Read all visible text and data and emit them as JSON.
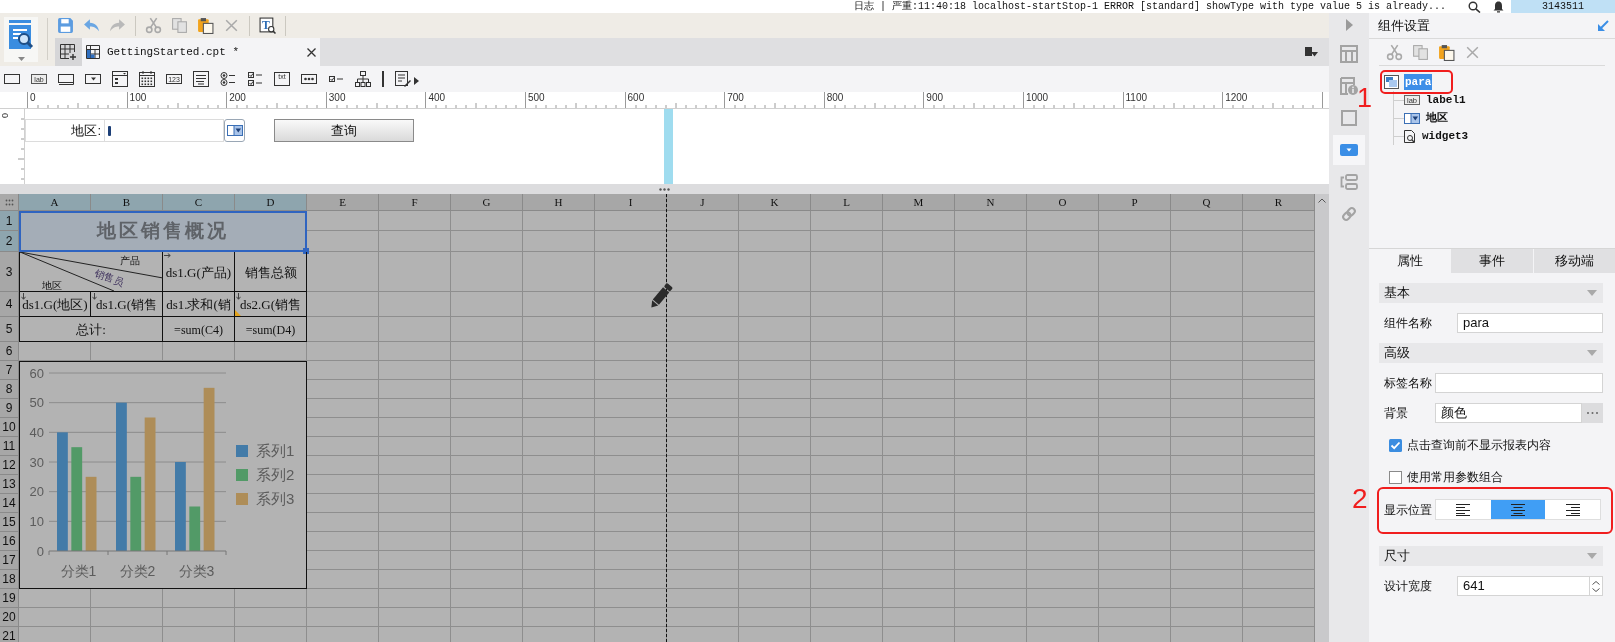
{
  "log_bar": {
    "message": "日志 | 严重:11:40:18 localhost-startStop-1 ERROR [standard] showType with type value 5 is already...",
    "counter": "3143511"
  },
  "toolbar": [
    {
      "kind": "save",
      "disabled": false
    },
    {
      "kind": "undo",
      "disabled": false
    },
    {
      "kind": "redo",
      "disabled": true
    },
    {
      "kind": "separator"
    },
    {
      "kind": "cut",
      "disabled": true
    },
    {
      "kind": "copy",
      "disabled": true
    },
    {
      "kind": "paste",
      "disabled": false
    },
    {
      "kind": "delete",
      "disabled": true
    },
    {
      "kind": "separator"
    },
    {
      "kind": "preview",
      "glyph": "T",
      "disabled": false
    },
    {
      "kind": "separator"
    }
  ],
  "document_tabs": [
    {
      "label": "GettingStarted.cpt *",
      "selected": true
    }
  ],
  "widget_toolbar": [
    {
      "kind": "text-field"
    },
    {
      "kind": "label",
      "glyph": "lab"
    },
    {
      "kind": "button"
    },
    {
      "kind": "dropdown"
    },
    {
      "kind": "dropdown-tree"
    },
    {
      "kind": "date"
    },
    {
      "kind": "number",
      "glyph": "123"
    },
    {
      "kind": "text-area"
    },
    {
      "kind": "radio-group"
    },
    {
      "kind": "checkbox-group"
    },
    {
      "kind": "file",
      "glyph": "txt"
    },
    {
      "kind": "password"
    },
    {
      "kind": "checkbox"
    },
    {
      "kind": "tree"
    },
    {
      "kind": "separator"
    },
    {
      "kind": "list-edit"
    },
    {
      "kind": "more"
    }
  ],
  "ruler": {
    "marks": [
      "0",
      "100",
      "200",
      "300",
      "400",
      "500",
      "600",
      "700",
      "800",
      "900",
      "1000",
      "1100",
      "1200"
    ],
    "vertical_marks": [
      "0"
    ]
  },
  "parameter_panel": {
    "label": "地区:",
    "field": {
      "focused": true
    },
    "button": "查询"
  },
  "sheet": {
    "columns": [
      {
        "label": "A",
        "selected": true
      },
      {
        "label": "B",
        "selected": true
      },
      {
        "label": "C",
        "selected": true
      },
      {
        "label": "D",
        "selected": true
      },
      {
        "label": "E",
        "selected": false
      },
      {
        "label": "F",
        "selected": false
      },
      {
        "label": "G",
        "selected": false
      },
      {
        "label": "H",
        "selected": false
      },
      {
        "label": "I",
        "selected": false
      },
      {
        "label": "J",
        "selected": false
      },
      {
        "label": "K",
        "selected": false
      },
      {
        "label": "L",
        "selected": false
      },
      {
        "label": "M",
        "selected": false
      },
      {
        "label": "N",
        "selected": false
      },
      {
        "label": "O",
        "selected": false
      },
      {
        "label": "P",
        "selected": false
      },
      {
        "label": "Q",
        "selected": false
      },
      {
        "label": "R",
        "selected": false
      }
    ],
    "rows": [
      {
        "label": "1",
        "selected": true
      },
      {
        "label": "2",
        "selected": true
      },
      {
        "label": "3",
        "selected": false
      },
      {
        "label": "4",
        "selected": false
      },
      {
        "label": "5",
        "selected": false
      },
      {
        "label": "6",
        "selected": false
      },
      {
        "label": "7",
        "selected": false
      },
      {
        "label": "8",
        "selected": false
      },
      {
        "label": "9",
        "selected": false
      },
      {
        "label": "10",
        "selected": false
      },
      {
        "label": "11",
        "selected": false
      },
      {
        "label": "12",
        "selected": false
      },
      {
        "label": "13",
        "selected": false
      },
      {
        "label": "14",
        "selected": false
      },
      {
        "label": "15",
        "selected": false
      },
      {
        "label": "16",
        "selected": false
      },
      {
        "label": "17",
        "selected": false
      },
      {
        "label": "18",
        "selected": false
      },
      {
        "label": "19",
        "selected": false
      },
      {
        "label": "20",
        "selected": false
      },
      {
        "label": "21",
        "selected": false
      }
    ]
  },
  "report": {
    "title": {
      "text": "地区销售概况",
      "selected": true
    },
    "slash_header": [
      "产品",
      "销售员",
      "地区"
    ],
    "header_cells": [
      {
        "text": "ds1.G(产品)",
        "expands_down": false,
        "expands_right": true,
        "flag": false
      },
      {
        "text": "销售总额",
        "expands_down": false,
        "expands_right": false,
        "flag": false
      }
    ],
    "data_cells": [
      {
        "text": "ds1.G(地区)",
        "expands_down": true,
        "expands_right": false,
        "flag": false
      },
      {
        "text": "ds1.G(销售",
        "expands_down": true,
        "expands_right": false,
        "flag": false
      },
      {
        "text": "ds1.求和(销",
        "expands_down": false,
        "expands_right": false,
        "flag": false
      },
      {
        "text": "ds2.G(销售",
        "expands_down": true,
        "expands_right": false,
        "flag": true
      }
    ],
    "total_cells": [
      "总计:",
      "=sum(C4)",
      "=sum(D4)"
    ],
    "chart": {
      "chart_data": {
        "type": "bar",
        "categories": [
          "分类1",
          "分类2",
          "分类3"
        ],
        "series": [
          {
            "name": "系列1",
            "color": "#437ba8",
            "values": [
              40,
              50,
              30
            ]
          },
          {
            "name": "系列2",
            "color": "#529a67",
            "values": [
              35,
              25,
              15
            ]
          },
          {
            "name": "系列3",
            "color": "#ae8d58",
            "values": [
              25,
              45,
              55
            ]
          }
        ],
        "ylim": [
          0,
          60
        ],
        "yticks": [
          0,
          10,
          20,
          30,
          40,
          50,
          60
        ],
        "grid": true,
        "legend": true
      }
    }
  },
  "side_strip": [
    {
      "kind": "collapse",
      "selected": false
    },
    {
      "kind": "cell-element",
      "selected": false
    },
    {
      "kind": "cell-attributes",
      "selected": false
    },
    {
      "kind": "widget-frame",
      "selected": false
    },
    {
      "kind": "widget-settings",
      "selected": true
    },
    {
      "kind": "widget-set",
      "selected": false
    },
    {
      "kind": "hyperlink",
      "selected": false
    }
  ],
  "component_settings": {
    "title": "组件设置",
    "toolbar": [
      {
        "kind": "cut",
        "disabled": true
      },
      {
        "kind": "copy",
        "disabled": true
      },
      {
        "kind": "paste",
        "disabled": false
      },
      {
        "kind": "delete",
        "disabled": true
      }
    ],
    "tree": {
      "label": "para",
      "kind": "form",
      "selected": true,
      "annotation": "1",
      "children": [
        {
          "label": "label1",
          "kind": "label",
          "glyph": "lab",
          "selected": false
        },
        {
          "label": "地区",
          "kind": "dropdown",
          "selected": false
        },
        {
          "label": "widget3",
          "kind": "search",
          "selected": false
        }
      ]
    }
  },
  "properties": {
    "tabs": [
      {
        "label": "属性",
        "selected": true
      },
      {
        "label": "事件",
        "selected": false
      },
      {
        "label": "移动端",
        "selected": false
      }
    ],
    "sections": [
      {
        "title": "基本",
        "expanded": true,
        "rows": [
          {
            "kind": "text",
            "label": "组件名称",
            "value": "para"
          }
        ]
      },
      {
        "title": "高级",
        "expanded": true,
        "rows": [
          {
            "kind": "text",
            "label": "标签名称"
          },
          {
            "kind": "picker",
            "label": "背景",
            "value": "颜色"
          },
          {
            "kind": "checkbox",
            "label": "点击查询前不显示报表内容",
            "checked": true
          },
          {
            "kind": "checkbox",
            "label": "使用常用参数组合",
            "checked": false
          },
          {
            "kind": "segmented",
            "label": "显示位置",
            "annotation": "2",
            "options": [
              {
                "kind": "left",
                "selected": false
              },
              {
                "kind": "center",
                "selected": true
              },
              {
                "kind": "right",
                "selected": false
              }
            ]
          }
        ]
      },
      {
        "title": "尺寸",
        "expanded": true,
        "rows": [
          {
            "kind": "spinner",
            "label": "设计宽度",
            "value": "641"
          }
        ]
      }
    ]
  }
}
